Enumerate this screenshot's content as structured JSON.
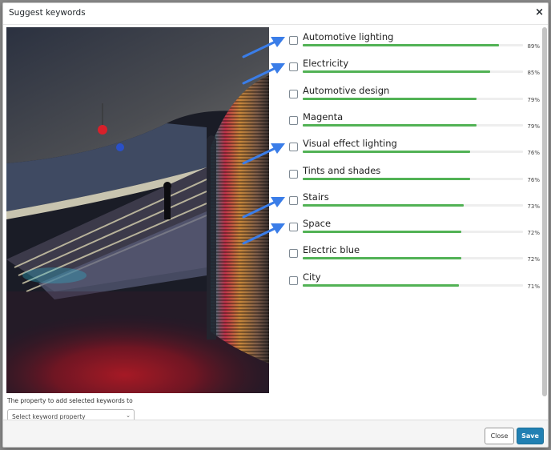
{
  "dialog": {
    "title": "Suggest keywords",
    "close_glyph": "×"
  },
  "image": {
    "subject": "escalator tunnel with neon light sculpture"
  },
  "property": {
    "label": "The property to add selected keywords to",
    "select_value": "Select keyword property",
    "caret": "⌄"
  },
  "keywords": [
    {
      "label": "Automotive lighting",
      "score": 89,
      "pct": "89%",
      "checked": false,
      "arrow": true
    },
    {
      "label": "Electricity",
      "score": 85,
      "pct": "85%",
      "checked": false,
      "arrow": true
    },
    {
      "label": "Automotive design",
      "score": 79,
      "pct": "79%",
      "checked": false,
      "arrow": false
    },
    {
      "label": "Magenta",
      "score": 79,
      "pct": "79%",
      "checked": false,
      "arrow": false
    },
    {
      "label": "Visual effect lighting",
      "score": 76,
      "pct": "76%",
      "checked": false,
      "arrow": true
    },
    {
      "label": "Tints and shades",
      "score": 76,
      "pct": "76%",
      "checked": false,
      "arrow": false
    },
    {
      "label": "Stairs",
      "score": 73,
      "pct": "73%",
      "checked": false,
      "arrow": true
    },
    {
      "label": "Space",
      "score": 72,
      "pct": "72%",
      "checked": false,
      "arrow": true
    },
    {
      "label": "Electric blue",
      "score": 72,
      "pct": "72%",
      "checked": false,
      "arrow": false
    },
    {
      "label": "City",
      "score": 71,
      "pct": "71%",
      "checked": false,
      "arrow": false
    }
  ],
  "footer": {
    "close_label": "Close",
    "save_label": "Save"
  },
  "colors": {
    "score_bar": "#52b255",
    "primary_button": "#2180b3",
    "annotation_arrow": "#3a7de8"
  }
}
